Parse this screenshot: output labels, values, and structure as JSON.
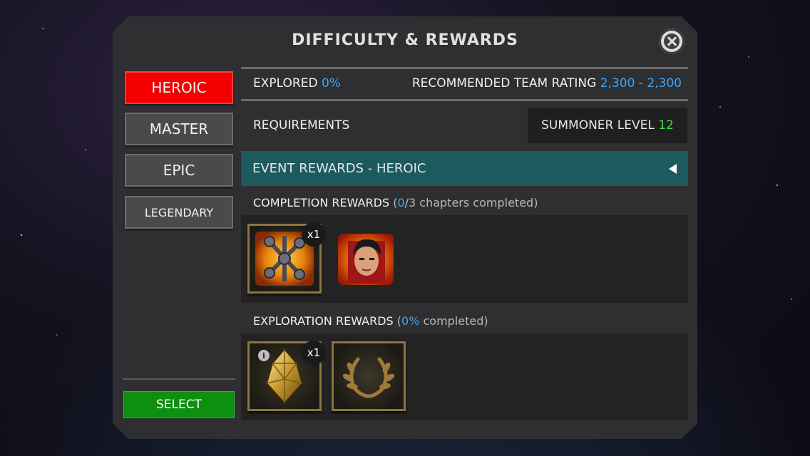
{
  "dialog": {
    "title": "DIFFICULTY & REWARDS"
  },
  "difficulties": [
    {
      "label": "HEROIC",
      "active": true
    },
    {
      "label": "MASTER",
      "active": false
    },
    {
      "label": "EPIC",
      "active": false
    },
    {
      "label": "LEGENDARY",
      "active": false
    }
  ],
  "select_label": "SELECT",
  "info": {
    "explored_label": "EXPLORED",
    "explored_value": "0%",
    "rating_label": "RECOMMENDED TEAM RATING",
    "rating_value": "2,300 - 2,300",
    "requirements_label": "REQUIREMENTS",
    "summoner_label": "SUMMONER LEVEL",
    "summoner_value": "12"
  },
  "event_rewards": {
    "label": "EVENT REWARDS - HEROIC"
  },
  "completion": {
    "label": "COMPLETION REWARDS",
    "open": "(",
    "progress": "0",
    "rest": "/3 chapters completed)",
    "items": [
      {
        "icon": "catalyst-icon",
        "count": "x1"
      },
      {
        "icon": "champion-portrait-icon"
      }
    ]
  },
  "exploration": {
    "label": "EXPLORATION REWARDS",
    "open": "(",
    "progress": "0%",
    "rest": " completed)",
    "items": [
      {
        "icon": "crystal-icon",
        "count": "x1",
        "info": "i"
      },
      {
        "icon": "laurel-wreath-icon"
      }
    ]
  },
  "colors": {
    "active_tab": "#f40000",
    "select_button": "#0d8f10",
    "event_bar": "#1c5a5e",
    "highlight_blue": "#3aa6ff",
    "highlight_green": "#3ee04a"
  }
}
